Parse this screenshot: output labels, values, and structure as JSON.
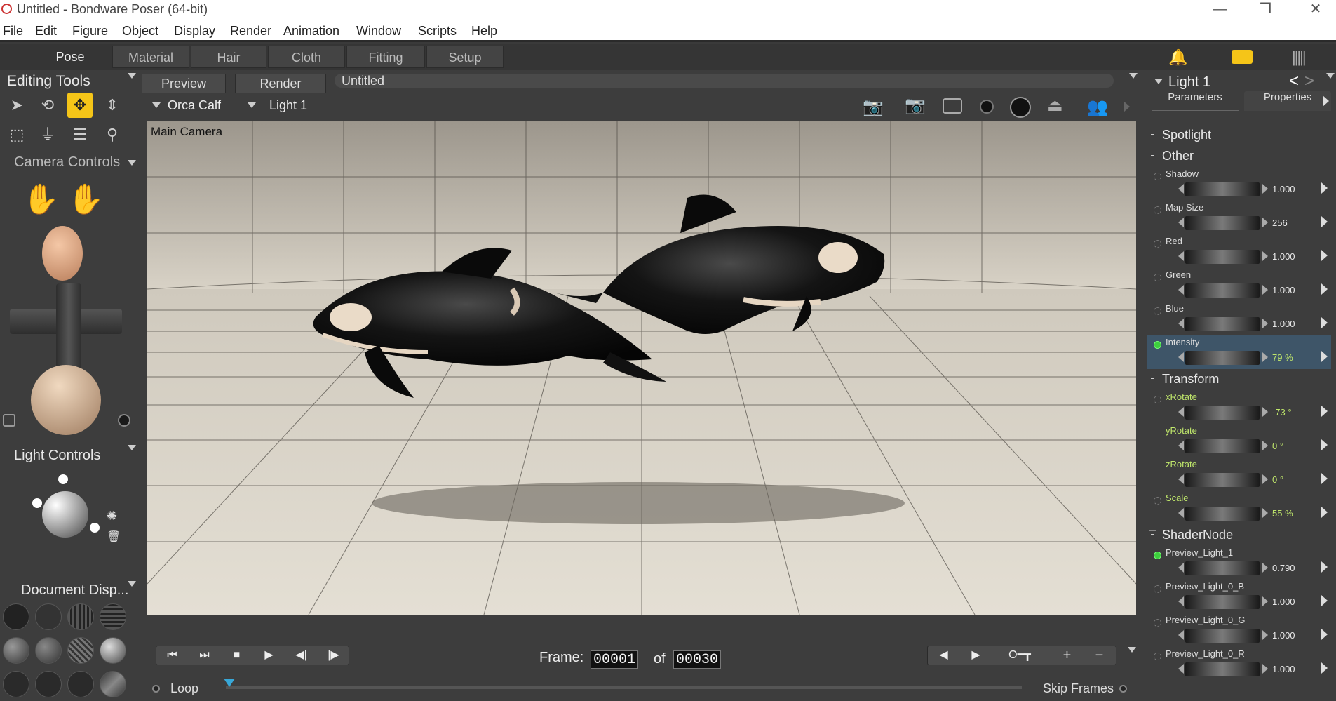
{
  "window": {
    "title": "Untitled - Bondware Poser (64-bit)",
    "minimize": "—",
    "restore": "❐",
    "close": "✕"
  },
  "menu": [
    "File",
    "Edit",
    "Figure",
    "Object",
    "Display",
    "Render",
    "Animation",
    "Window",
    "Scripts",
    "Help"
  ],
  "rooms": [
    "Pose",
    "Material",
    "Hair",
    "Cloth",
    "Fitting",
    "Setup"
  ],
  "left_panel": {
    "editing_tools": "Editing Tools",
    "camera_controls": "Camera Controls",
    "light_controls": "Light Controls",
    "document_display": "Document  Disp..."
  },
  "document": {
    "tabs": [
      "Preview",
      "Render"
    ],
    "doc_title": "Untitled",
    "figure_select": "Orca Calf",
    "actor_select": "Light 1",
    "camera_label": "Main Camera"
  },
  "timeline": {
    "frame_label": "Frame:",
    "frame": "00001",
    "of_label": "of",
    "total": "00030",
    "loop_label": "Loop",
    "skip_frames_label": "Skip Frames",
    "key_symbol": "O━┳",
    "plus": "+",
    "minus": "−"
  },
  "right_panel": {
    "title": "Light 1",
    "tabs": [
      "Parameters",
      "Properties"
    ],
    "sections": {
      "spotlight": "Spotlight",
      "other": "Other",
      "transform": "Transform",
      "shadernode": "ShaderNode"
    },
    "params": [
      {
        "label": "Shadow",
        "value": "1.000"
      },
      {
        "label": "Map Size",
        "value": "256"
      },
      {
        "label": "Red",
        "value": "1.000"
      },
      {
        "label": "Green",
        "value": "1.000"
      },
      {
        "label": "Blue",
        "value": "1.000"
      },
      {
        "label": "Intensity",
        "value": "79 %"
      },
      {
        "label": "xRotate",
        "value": "-73 °"
      },
      {
        "label": "yRotate",
        "value": "0 °"
      },
      {
        "label": "zRotate",
        "value": "0 °"
      },
      {
        "label": "Scale",
        "value": "55 %"
      },
      {
        "label": "Preview_Light_1",
        "value": "0.790"
      },
      {
        "label": "Preview_Light_0_B",
        "value": "1.000"
      },
      {
        "label": "Preview_Light_0_G",
        "value": "1.000"
      },
      {
        "label": "Preview_Light_0_R",
        "value": "1.000"
      }
    ]
  },
  "colors": {
    "accent_tool": "#f5c518",
    "chat_icon": "#f5c518",
    "selected_param": "#3e5568",
    "param_green": "#bfe66b"
  }
}
